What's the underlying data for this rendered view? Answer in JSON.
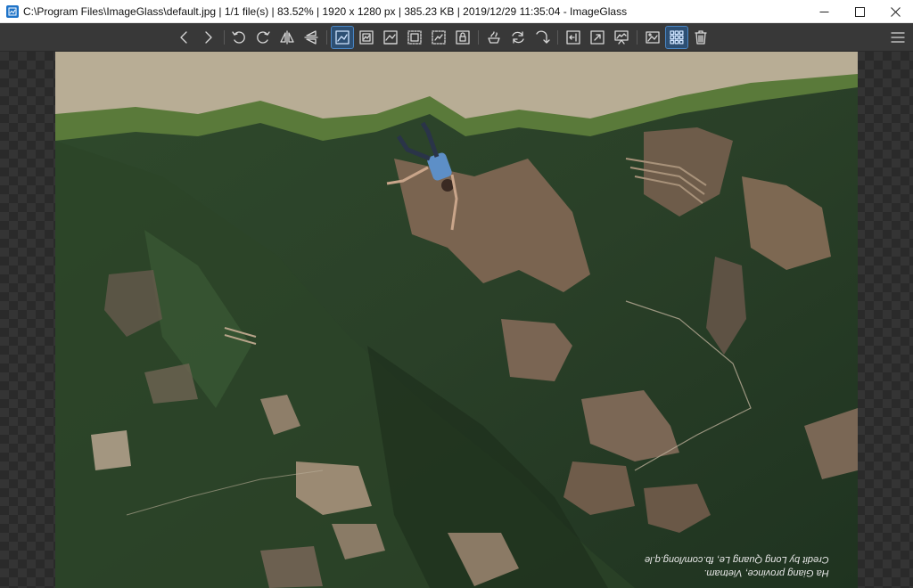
{
  "window": {
    "title": "C:\\Program Files\\ImageGlass\\default.jpg  |  1/1 file(s)  |  83.52%  |  1920 x 1280 px  |  385.23 KB  |  2019/12/29 11:35:04  - ImageGlass",
    "controls": [
      "minimize",
      "maximize",
      "close"
    ]
  },
  "toolbar": {
    "buttons": [
      {
        "name": "previous-image",
        "icon": "chevron-left-icon"
      },
      {
        "name": "next-image",
        "icon": "chevron-right-icon"
      },
      {
        "name": "rotate-left",
        "icon": "rotate-left-icon"
      },
      {
        "name": "rotate-right",
        "icon": "rotate-right-icon"
      },
      {
        "name": "flip-horizontal",
        "icon": "flip-horizontal-icon"
      },
      {
        "name": "flip-vertical",
        "icon": "flip-vertical-icon"
      },
      {
        "name": "auto-zoom",
        "icon": "auto-zoom-icon",
        "active": true
      },
      {
        "name": "lock-zoom",
        "icon": "lock-zoom-icon"
      },
      {
        "name": "scale-to-width",
        "icon": "scale-width-icon"
      },
      {
        "name": "scale-to-height",
        "icon": "scale-height-icon"
      },
      {
        "name": "scale-to-fit",
        "icon": "scale-fit-icon"
      },
      {
        "name": "scale-to-fill",
        "icon": "lock-icon"
      },
      {
        "name": "open-with",
        "icon": "open-with-icon"
      },
      {
        "name": "refresh",
        "icon": "refresh-icon"
      },
      {
        "name": "go-to-image",
        "icon": "goto-icon"
      },
      {
        "name": "view-fullscreen",
        "icon": "fullscreen-icon"
      },
      {
        "name": "view-exit-fullscreen",
        "icon": "frameless-icon"
      },
      {
        "name": "slideshow",
        "icon": "slideshow-icon"
      },
      {
        "name": "set-wallpaper",
        "icon": "wallpaper-icon"
      },
      {
        "name": "thumbnail-bar",
        "icon": "thumbnails-icon",
        "active": true
      },
      {
        "name": "delete",
        "icon": "trash-icon"
      },
      {
        "name": "main-menu",
        "icon": "hamburger-icon"
      }
    ]
  },
  "image": {
    "credit_line1": "Ha Giang province, Vietnam.",
    "credit_line2": "Credit by Long Quang Le, fb.com/long.q.le"
  },
  "colors": {
    "accent": "#1e73c8",
    "toolbar_bg": "#383838",
    "active_button_bg": "#2d4f73"
  }
}
